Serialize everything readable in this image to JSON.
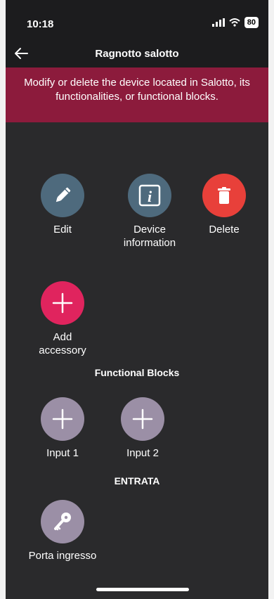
{
  "status": {
    "time": "10:18",
    "battery": "80"
  },
  "header": {
    "title": "Ragnotto salotto"
  },
  "banner": {
    "line1": "Modify or delete the device located in Salotto, its",
    "line2": "functionalities, or functional blocks."
  },
  "actions": {
    "edit": {
      "line1": "Edit",
      "icon": "pencil-icon"
    },
    "info": {
      "line1": "Device",
      "line2": "information",
      "icon": "info-icon"
    },
    "delete": {
      "line1": "Delete",
      "icon": "trash-icon"
    },
    "add_accessory": {
      "line1": "Add",
      "line2": "accessory",
      "icon": "plus-icon"
    }
  },
  "sections": {
    "functional_blocks": "Functional Blocks",
    "entrata": "ENTRATA"
  },
  "blocks": {
    "input1": {
      "label": "Input 1",
      "icon": "plus-icon"
    },
    "input2": {
      "label": "Input 2",
      "icon": "plus-icon"
    },
    "porta": {
      "label": "Porta ingresso",
      "icon": "key-icon"
    }
  },
  "colors": {
    "background": "#2a2a2c",
    "bar": "#1c1c1e",
    "banner": "#8c1b3c",
    "edit_info": "#4e6a7d",
    "delete": "#e8403a",
    "accent": "#e0245e",
    "block": "#9b8fa6"
  }
}
